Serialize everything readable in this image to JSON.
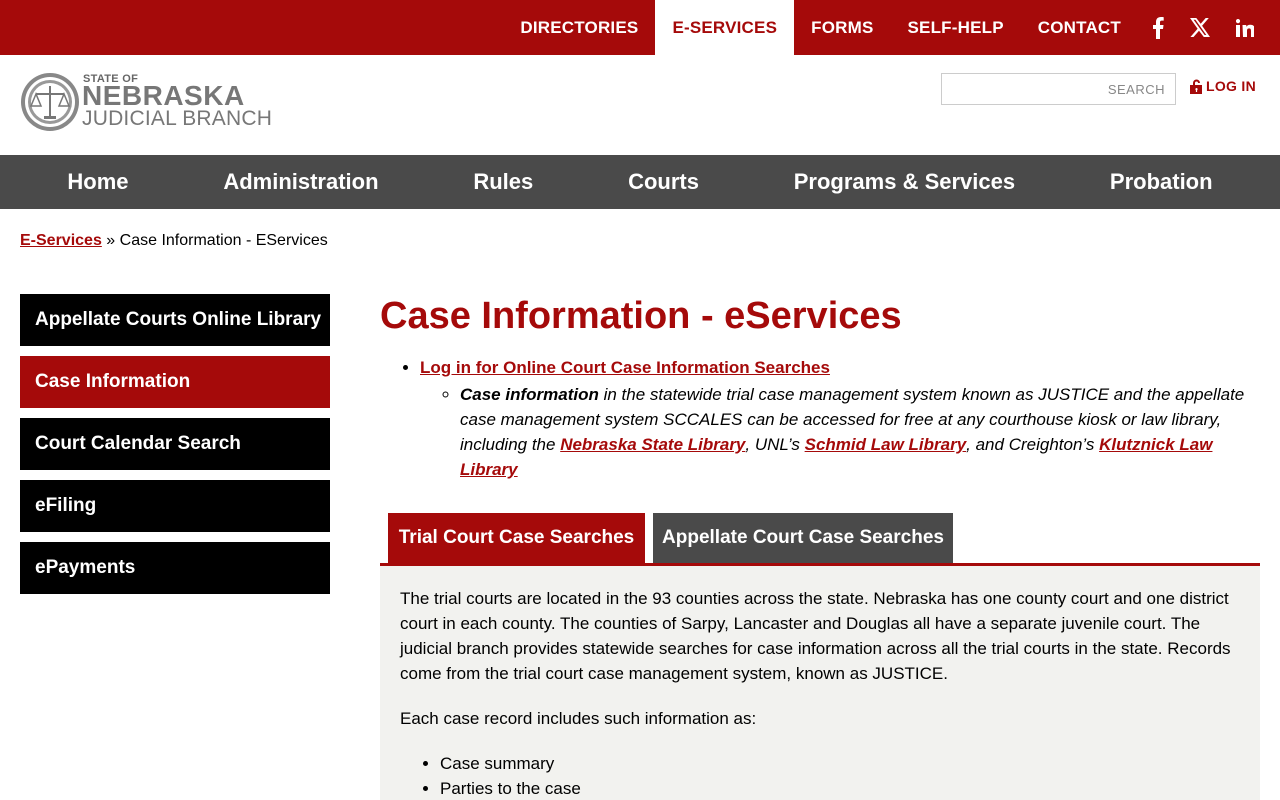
{
  "topnav": {
    "items": [
      "DIRECTORIES",
      "E-SERVICES",
      "FORMS",
      "SELF-HELP",
      "CONTACT"
    ],
    "active_index": 1,
    "social": [
      "facebook-icon",
      "x-icon",
      "linkedin-icon"
    ]
  },
  "header": {
    "logo": {
      "line1": "STATE OF",
      "line2": "NEBRASKA",
      "line3": "JUDICIAL BRANCH"
    },
    "search_placeholder": "SEARCH",
    "login_label": "LOG IN"
  },
  "mainnav": [
    "Home",
    "Administration",
    "Rules",
    "Courts",
    "Programs & Services",
    "Probation"
  ],
  "breadcrumb": {
    "link": "E-Services",
    "separator": "»",
    "current": "Case Information - EServices"
  },
  "sidebar": {
    "items": [
      "Appellate Courts Online Library",
      "Case Information",
      "Court Calendar Search",
      "eFiling",
      "ePayments"
    ],
    "active_index": 1
  },
  "content": {
    "title": "Case Information - eServices",
    "login_link": "Log in for Online Court Case Information Searches",
    "sub": {
      "bold": "Case information",
      "text1": " in the statewide trial case management system known as JUSTICE and the appellate case management system SCCALES can be accessed for free at any courthouse kiosk or law library, including the ",
      "link1": "Nebraska State Library",
      "text2": ", UNL’s ",
      "link2": "Schmid Law Library",
      "text3": ", and Creighton’s ",
      "link3": "Klutznick Law Library"
    },
    "tabs": [
      "Trial Court Case Searches",
      "Appellate Court Case Searches"
    ],
    "panel": {
      "para1": "The trial courts are located in the 93 counties across the state.  Nebraska has one county court and one district court in each county.  The counties of Sarpy, Lancaster and Douglas all have a separate juvenile court.  The judicial branch provides statewide searches for case information across all the trial courts in the state.  Records come from the trial court case management system, known as JUSTICE.",
      "para2": "Each case record includes such information as:",
      "list": [
        "Case summary",
        "Parties to the case"
      ]
    }
  },
  "colors": {
    "brand_red": "#a50a0a",
    "nav_gray": "#4a4a4a",
    "panel_bg": "#f2f2ef"
  }
}
